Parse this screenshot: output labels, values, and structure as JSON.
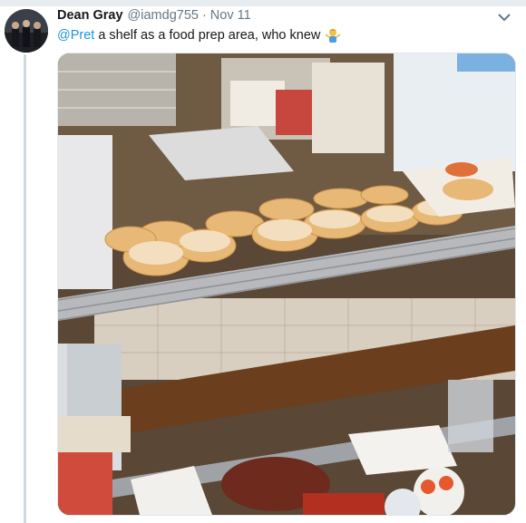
{
  "tweet": {
    "display_name": "Dean Gray",
    "handle": "@iamdg755",
    "separator": "·",
    "timestamp": "Nov 11",
    "mention": "@Pret",
    "text": "a shelf as a food prep area, who knew",
    "emoji": "person-shrugging-emoji",
    "caret_icon": "chevron-down-icon"
  },
  "media": {
    "description_icon": "photo"
  },
  "colors": {
    "link": "#1b95e0",
    "name": "#14171a",
    "meta": "#657786",
    "thread_line": "#cfd9de"
  }
}
